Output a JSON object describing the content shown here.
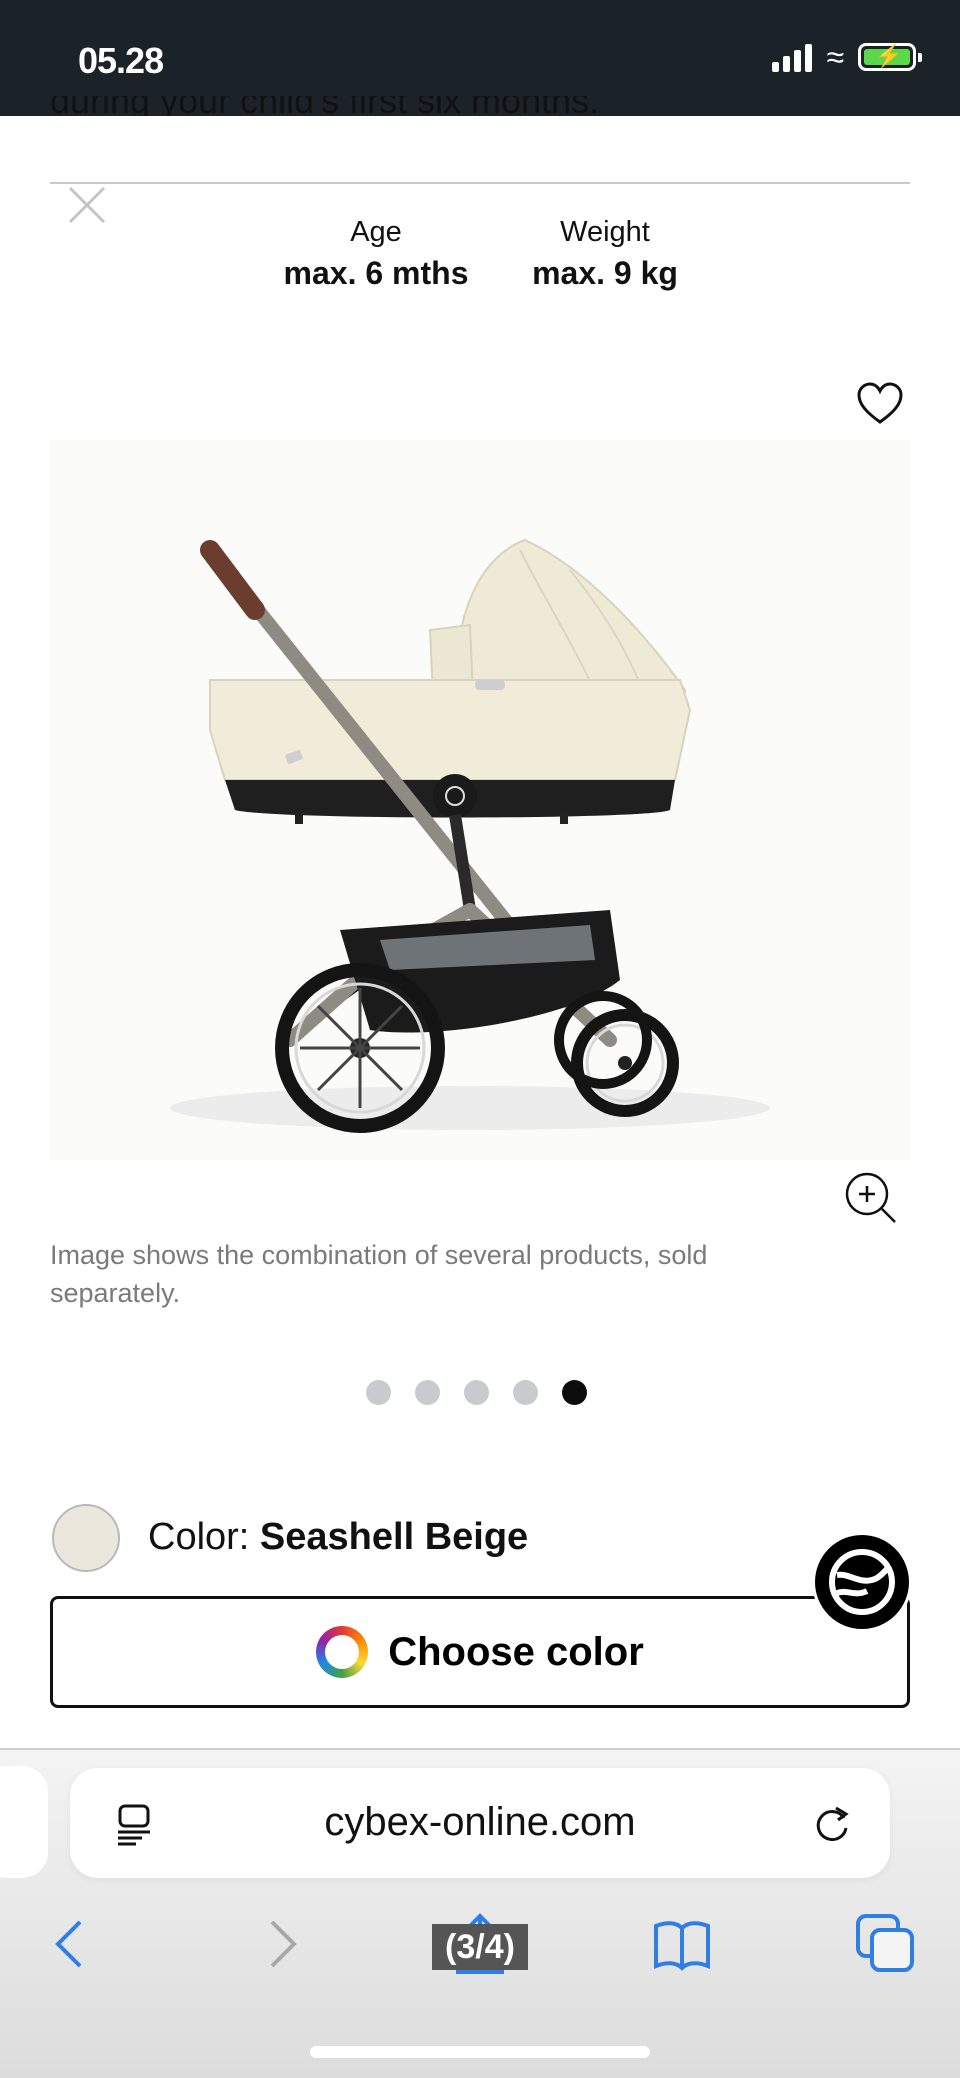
{
  "status_bar": {
    "time": "05.28"
  },
  "content": {
    "cut_text": "during your child's first six months."
  },
  "specs": [
    {
      "label": "Age",
      "value": "max. 6 mths"
    },
    {
      "label": "Weight",
      "value": "max. 9 kg"
    }
  ],
  "product": {
    "disclaimer": "Image shows the combination of several products, sold separately.",
    "carousel": {
      "total": 5,
      "active_index": 5
    },
    "color_prefix": "Color: ",
    "color_name": "Seashell Beige",
    "swatch_color": "#ebe7dd",
    "choose_color_label": "Choose color"
  },
  "browser": {
    "url": "cybex-online.com",
    "page_indicator": "(3/4)",
    "accent_color": "#2f7ee6"
  },
  "icons": {
    "close": "close-icon",
    "favorite": "heart-icon",
    "zoom": "zoom-in-icon",
    "chat": "cybex-logo-icon",
    "reader": "reader-icon",
    "reload": "reload-icon",
    "back": "chevron-left-icon",
    "forward": "chevron-right-icon",
    "share": "share-icon",
    "bookmarks": "book-icon",
    "tabs": "tabs-icon"
  }
}
